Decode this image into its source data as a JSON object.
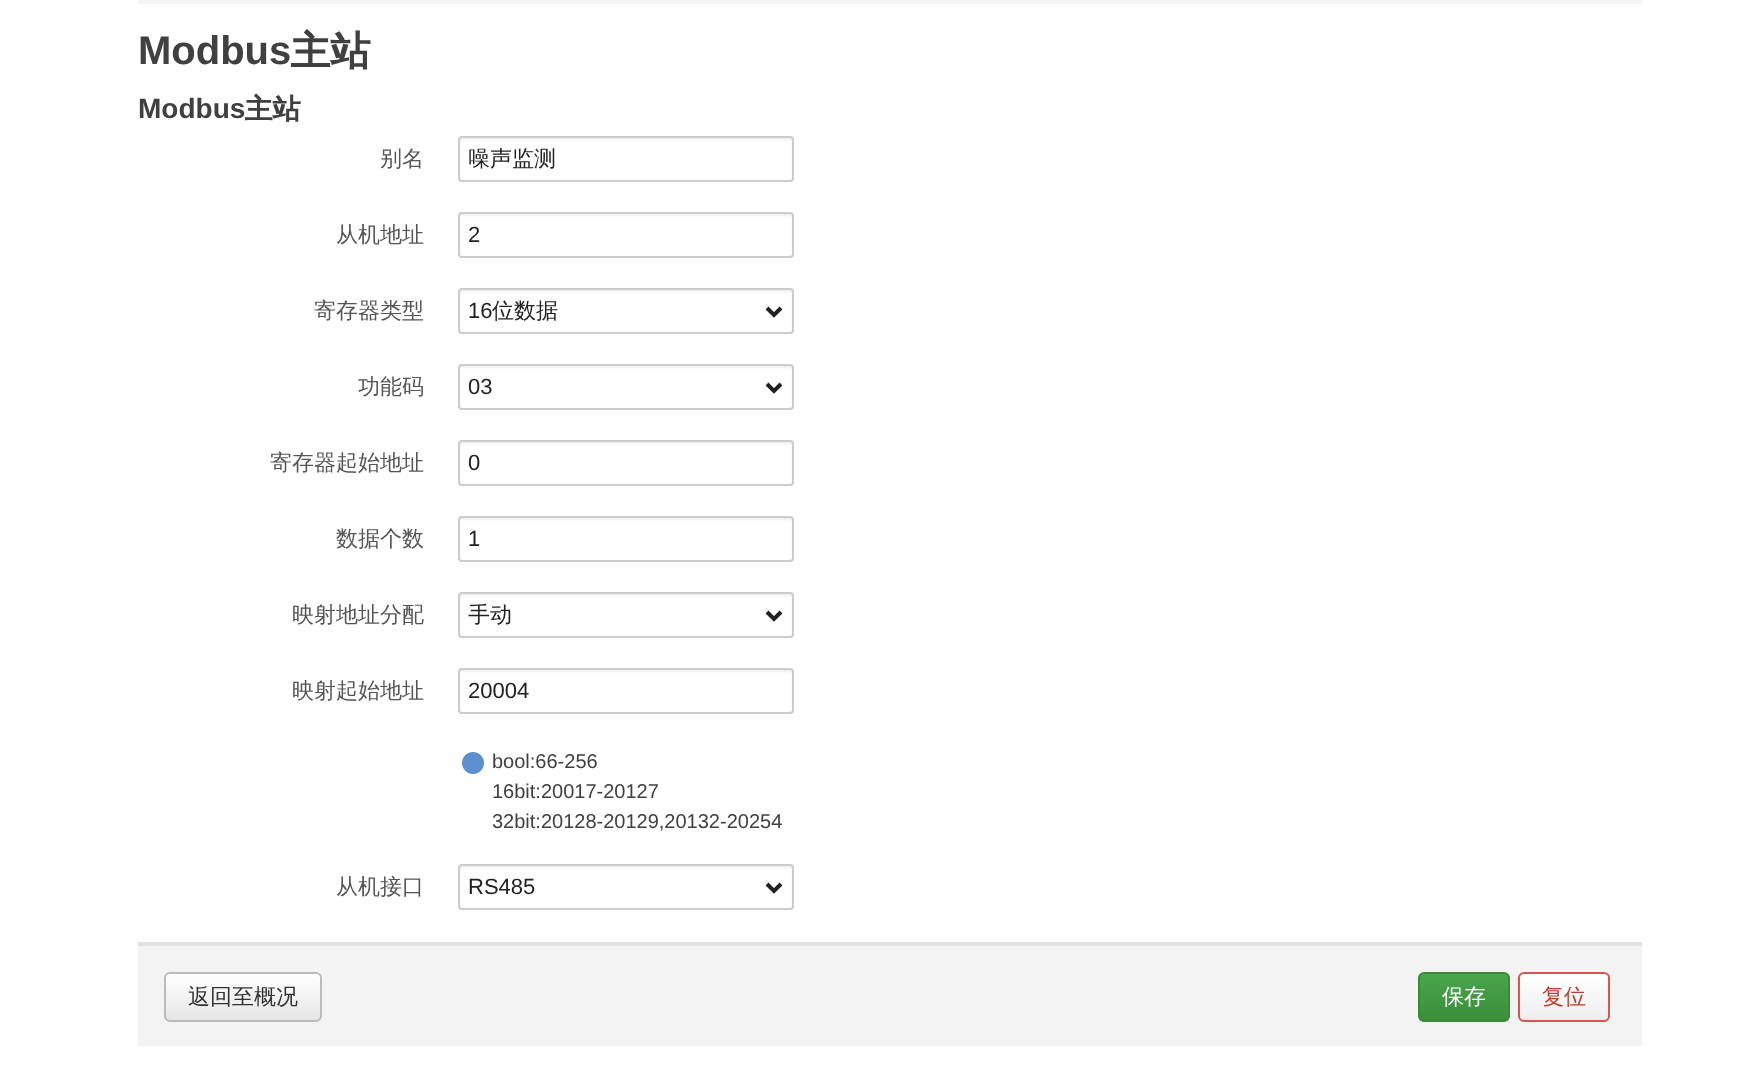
{
  "page_title": "Modbus主站",
  "section_title": "Modbus主站",
  "fields": [
    {
      "kind": "text",
      "label": "别名",
      "value": "噪声监测"
    },
    {
      "kind": "text",
      "label": "从机地址",
      "value": "2"
    },
    {
      "kind": "select",
      "label": "寄存器类型",
      "value": "16位数据"
    },
    {
      "kind": "select",
      "label": "功能码",
      "value": "03"
    },
    {
      "kind": "text",
      "label": "寄存器起始地址",
      "value": "0"
    },
    {
      "kind": "text",
      "label": "数据个数",
      "value": "1"
    },
    {
      "kind": "select",
      "label": "映射地址分配",
      "value": "手动"
    },
    {
      "kind": "text",
      "label": "映射起始地址",
      "value": "20004"
    },
    {
      "kind": "hint",
      "lines": [
        "bool:66-256",
        "16bit:20017-20127",
        "32bit:20128-20129,20132-20254"
      ]
    },
    {
      "kind": "select",
      "label": "从机接口",
      "value": "RS485"
    }
  ],
  "footer": {
    "back_button": "返回至概况",
    "save_button": "保存",
    "reset_button": "复位"
  }
}
